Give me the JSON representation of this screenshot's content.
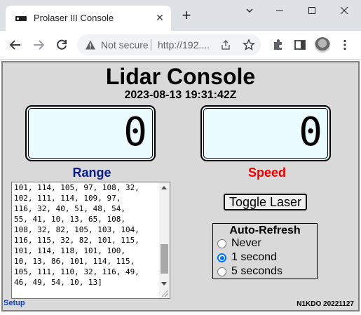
{
  "browser": {
    "tab_title": "Prolaser III Console",
    "tab_close": "✕",
    "new_tab": "+",
    "security_status": "Not secure",
    "url": "http://192...."
  },
  "page": {
    "title": "Lidar Console",
    "timestamp": "2023-08-13 19:31:42Z",
    "range_value": "0",
    "speed_value": "0",
    "range_label": "Range",
    "speed_label": "Speed",
    "log_text": "101, 114, 105, 97, 108, 32,\n102, 111, 114, 109, 97,\n116, 32, 40, 51, 48, 54,\n55, 41, 10, 13, 65, 108,\n108, 32, 82, 105, 103, 104,\n116, 115, 32, 82, 101, 115,\n101, 114, 118, 101, 100,\n10, 13, 86, 101, 114, 115,\n105, 111, 110, 32, 116, 49,\n46, 49, 54, 10, 13]",
    "toggle_label": "Toggle Laser",
    "auto_refresh": {
      "title": "Auto-Refresh",
      "options": [
        "Never",
        "1 second",
        "5 seconds"
      ],
      "selected": "1 second"
    },
    "setup_link": "Setup",
    "version": "N1KDO 20221127"
  },
  "colors": {
    "range_label": "#0a1a8c",
    "speed_label": "#ee0000",
    "display_bg": "#eafcff",
    "console_bg": "#d9d9d9",
    "radio_accent": "#0075ff"
  }
}
